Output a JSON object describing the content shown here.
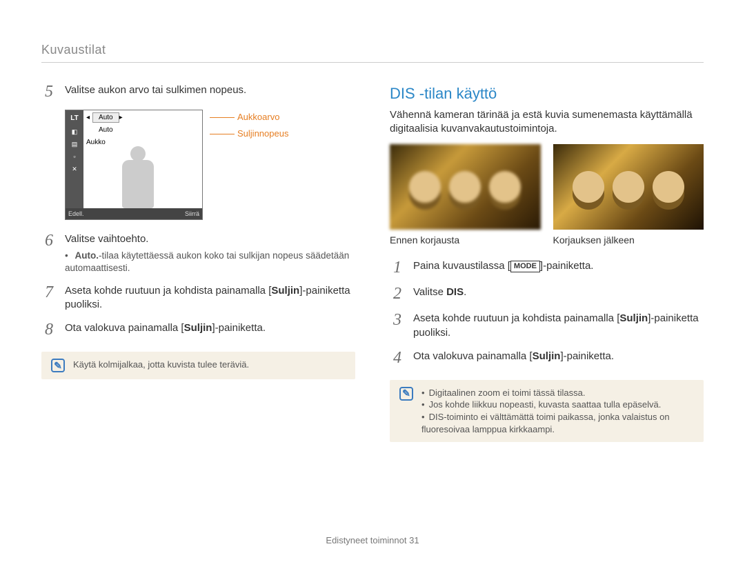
{
  "header": {
    "section_title": "Kuvaustilat"
  },
  "left": {
    "step5": {
      "num": "5",
      "text": "Valitse aukon arvo tai sulkimen nopeus."
    },
    "screen": {
      "lt": "LT",
      "auto1": "Auto",
      "auto2": "Auto",
      "aukko": "Aukko",
      "footer_left": "Edell.",
      "footer_right": "Siirrä",
      "leader1": "Aukkoarvo",
      "leader2": "Suljinnopeus"
    },
    "step6": {
      "num": "6",
      "text": "Valitse vaihtoehto.",
      "bullet_bold": "Auto.",
      "bullet_rest": "-tilaa käytettäessä aukon koko tai sulkijan nopeus säädetään automaattisesti."
    },
    "step7": {
      "num": "7",
      "text": "Aseta kohde ruutuun ja kohdista painamalla [",
      "bold": "Suljin",
      "after": "]-painiketta puoliksi."
    },
    "step8": {
      "num": "8",
      "text": "Ota valokuva painamalla [",
      "bold": "Suljin",
      "after": "]-painiketta."
    },
    "note": "Käytä kolmijalkaa, jotta kuvista tulee teräviä."
  },
  "right": {
    "heading": "DIS -tilan käyttö",
    "intro": "Vähennä kameran tärinää ja estä kuvia sumenemasta käyttämällä digitaalisia kuvanvakautustoimintoja.",
    "caption_before": "Ennen korjausta",
    "caption_after": "Korjauksen jälkeen",
    "step1": {
      "num": "1",
      "text_before": "Paina kuvaustilassa [",
      "mode": "MODE",
      "text_after": "]-painiketta."
    },
    "step2": {
      "num": "2",
      "text": "Valitse ",
      "bold": "DIS",
      "after": "."
    },
    "step3": {
      "num": "3",
      "text": "Aseta kohde ruutuun ja kohdista painamalla [",
      "bold": "Suljin",
      "after": "]-painiketta puoliksi."
    },
    "step4": {
      "num": "4",
      "text": "Ota valokuva painamalla [",
      "bold": "Suljin",
      "after": "]-painiketta."
    },
    "note_items": [
      "Digitaalinen zoom ei toimi tässä tilassa.",
      "Jos kohde liikkuu nopeasti, kuvasta saattaa tulla epäselvä.",
      "DIS-toiminto ei välttämättä toimi paikassa, jonka valaistus on fluoresoivaa lamppua kirkkaampi."
    ]
  },
  "footer": {
    "label": "Edistyneet toiminnot",
    "page": "31"
  }
}
